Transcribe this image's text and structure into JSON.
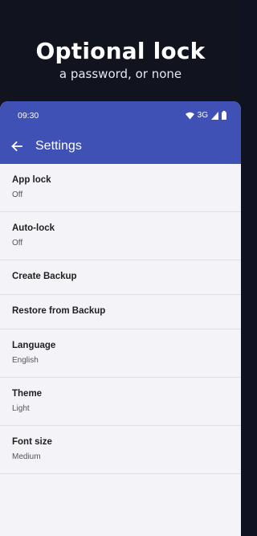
{
  "promo": {
    "title": "Optional lock",
    "subtitle": "a password, or none"
  },
  "status_bar": {
    "time": "09:30",
    "network": "3G",
    "icons": [
      "wifi-icon",
      "signal-icon",
      "battery-icon"
    ]
  },
  "app_bar": {
    "title": "Settings",
    "back_icon": "arrow-left-icon"
  },
  "settings": {
    "items": [
      {
        "title": "App lock",
        "value": "Off"
      },
      {
        "title": "Auto-lock",
        "value": "Off"
      },
      {
        "title": "Create Backup"
      },
      {
        "title": "Restore from Backup"
      },
      {
        "title": "Language",
        "value": "English"
      },
      {
        "title": "Theme",
        "value": "Light"
      },
      {
        "title": "Font size",
        "value": "Medium"
      }
    ]
  },
  "colors": {
    "primary": "#3f51b5",
    "promo_background": "#11131f",
    "list_background": "#f4f4f8"
  }
}
